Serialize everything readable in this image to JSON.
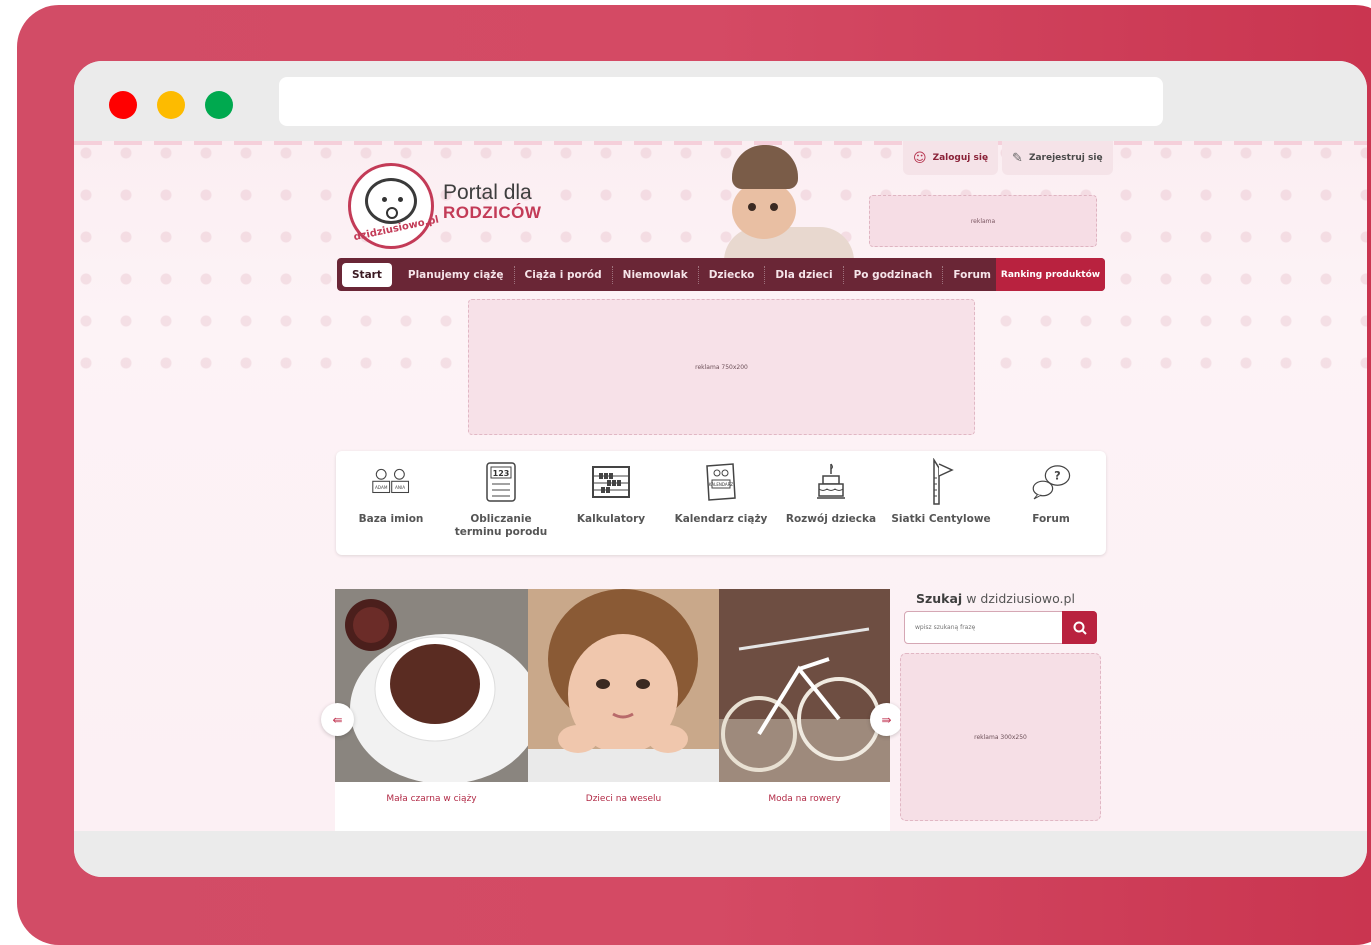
{
  "window": {
    "controls": [
      "close",
      "minimize",
      "maximize"
    ],
    "url": ""
  },
  "header": {
    "logo_text": "dzidziusiowo.pl",
    "portal_title": "Portal dla",
    "portal_subtitle": "RODZICÓW",
    "login_label": "Zaloguj się",
    "register_label": "Zarejestruj się",
    "ad_small": "reklama"
  },
  "nav": {
    "items": [
      "Start",
      "Planujemy ciążę",
      "Ciąża i poród",
      "Niemowlak",
      "Dziecko",
      "Dla dzieci",
      "Po godzinach",
      "Forum"
    ],
    "ranking": "Ranking produktów"
  },
  "ad_banner": "reklama 750x200",
  "tools": [
    {
      "label": "Baza imion",
      "icon": "name-tags-icon"
    },
    {
      "label": "Obliczanie terminu porodu",
      "icon": "calculator-icon"
    },
    {
      "label": "Kalkulatory",
      "icon": "abacus-icon"
    },
    {
      "label": "Kalendarz ciąży",
      "icon": "calendar-book-icon"
    },
    {
      "label": "Rozwój dziecka",
      "icon": "birthday-cake-icon"
    },
    {
      "label": "Siatki Centylowe",
      "icon": "growth-chart-icon"
    },
    {
      "label": "Forum",
      "icon": "speech-bubbles-icon"
    }
  ],
  "tool_icon_text": {
    "name1": "ADAM",
    "name2": "ANIA",
    "calc": "123",
    "kalendarz": "KALENDARZ"
  },
  "slider": {
    "slides": [
      {
        "caption": "Mała czarna w ciąży"
      },
      {
        "caption": "Dzieci na weselu"
      },
      {
        "caption": "Moda na rowery"
      }
    ]
  },
  "search": {
    "title_bold": "Szukaj",
    "title_rest": "w dzidziusiowo.pl",
    "placeholder": "wpisz szukaną frazę"
  },
  "ad_side": "reklama 300x250",
  "colors": {
    "brand": "#c33b57",
    "nav_bg": "#6a2636",
    "ranking_bg": "#b9223f",
    "frame": "#d24c66"
  }
}
